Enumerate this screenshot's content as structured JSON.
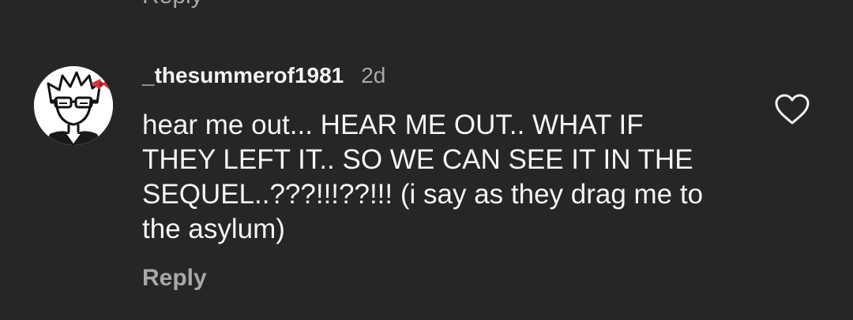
{
  "previous_comment": {
    "reply_label": "Reply"
  },
  "comment": {
    "username": "_thesummerof1981",
    "time": "2d",
    "text": "hear me out... HEAR ME OUT.. WHAT IF\nTHEY LEFT IT.. SO WE CAN SEE IT IN THE\nSEQUEL..???!!!??!!! (i say as they drag me to\nthe asylum)",
    "reply_label": "Reply",
    "like_icon": "heart-outline-icon"
  },
  "colors": {
    "background": "#262626",
    "primary_text": "#f5f5f5",
    "secondary_text": "#a8a8a8"
  }
}
